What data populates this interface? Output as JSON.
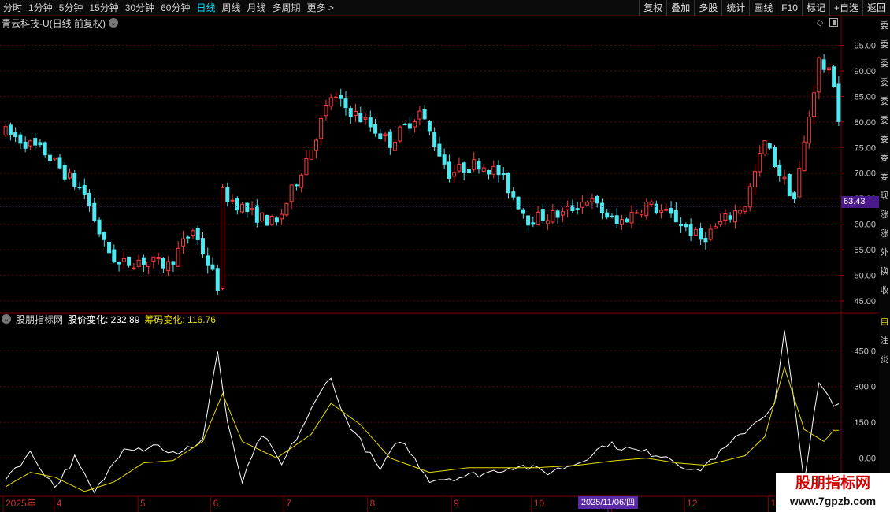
{
  "timeframes": [
    {
      "label": "分时",
      "active": false
    },
    {
      "label": "1分钟",
      "active": false
    },
    {
      "label": "5分钟",
      "active": false
    },
    {
      "label": "15分钟",
      "active": false
    },
    {
      "label": "30分钟",
      "active": false
    },
    {
      "label": "60分钟",
      "active": false
    },
    {
      "label": "日线",
      "active": true
    },
    {
      "label": "周线",
      "active": false
    },
    {
      "label": "月线",
      "active": false
    },
    {
      "label": "多周期",
      "active": false
    },
    {
      "label": "更多 >",
      "active": false
    }
  ],
  "toolbar_right": [
    "复权",
    "叠加",
    "多股",
    "统计",
    "画线",
    "F10",
    "标记",
    "+自选",
    "返回"
  ],
  "main_header": "青云科技-U(日线 前复权)",
  "indicator": {
    "name": "股朋指标网",
    "line1_label": "股价变化: 232.89",
    "line2_label": "筹码变化: 116.76"
  },
  "price_axis": [
    "95.00",
    "90.00",
    "85.00",
    "80.00",
    "75.00",
    "70.00",
    "65.00",
    "60.00",
    "55.00",
    "50.00",
    "45.00"
  ],
  "indicator_axis": [
    "450.0",
    "300.0",
    "150.0",
    "0.00"
  ],
  "current_price": "63.43",
  "months": [
    "2025年",
    "4",
    "5",
    "6",
    "7",
    "8",
    "9",
    "10",
    "11",
    "12",
    "1"
  ],
  "crosshair_date": "2025/11/06/四",
  "right_strip_top": [
    "委",
    "委",
    "委",
    "委",
    "委",
    "委",
    "委",
    "委",
    "委",
    "现",
    "涨",
    "涨",
    "外",
    "换",
    "收"
  ],
  "right_strip_bottom": [
    "自",
    "注",
    "炎"
  ],
  "watermark": {
    "title": "股朋指标网",
    "url": "www.7gpzb.com"
  },
  "colors": {
    "up": "#ff3b3b",
    "down": "#4ee8f0",
    "line1": "#ffffff",
    "line2": "#e6dc00",
    "grid": "#5a0a0a"
  },
  "chart_data": [
    {
      "type": "candlestick",
      "title": "青云科技-U(日线 前复权)",
      "ylim": [
        43,
        98
      ],
      "x_ticks": [
        "2025年",
        "4",
        "5",
        "6",
        "7",
        "8",
        "9",
        "10",
        "11",
        "12",
        "1"
      ],
      "close_path": [
        [
          0,
          78
        ],
        [
          8,
          74
        ],
        [
          16,
          66
        ],
        [
          20,
          56
        ],
        [
          23,
          52
        ],
        [
          27,
          53
        ],
        [
          33,
          52
        ],
        [
          38,
          59
        ],
        [
          43,
          48
        ],
        [
          44,
          66
        ],
        [
          50,
          62
        ],
        [
          55,
          60
        ],
        [
          62,
          75
        ],
        [
          66,
          85
        ],
        [
          73,
          80
        ],
        [
          78,
          76
        ],
        [
          84,
          82
        ],
        [
          90,
          70
        ],
        [
          96,
          72
        ],
        [
          100,
          70
        ],
        [
          106,
          61
        ],
        [
          113,
          62
        ],
        [
          118,
          65
        ],
        [
          124,
          60
        ],
        [
          130,
          64
        ],
        [
          136,
          61
        ],
        [
          141,
          57
        ],
        [
          150,
          64
        ],
        [
          154,
          76
        ],
        [
          157,
          70
        ],
        [
          160,
          65
        ],
        [
          165,
          92
        ],
        [
          168,
          88
        ],
        [
          170,
          73
        ]
      ],
      "current_price": 63.43
    },
    {
      "type": "line",
      "title": "股朋指标网",
      "ylim": [
        -160,
        560
      ],
      "series": [
        {
          "name": "股价变化",
          "current": 232.89,
          "points": [
            [
              0,
              -80
            ],
            [
              5,
              20
            ],
            [
              10,
              -120
            ],
            [
              14,
              0
            ],
            [
              18,
              -150
            ],
            [
              24,
              50
            ],
            [
              28,
              40
            ],
            [
              30,
              60
            ],
            [
              35,
              10
            ],
            [
              40,
              80
            ],
            [
              43,
              450
            ],
            [
              45,
              140
            ],
            [
              48,
              -100
            ],
            [
              52,
              100
            ],
            [
              56,
              -30
            ],
            [
              62,
              200
            ],
            [
              66,
              350
            ],
            [
              68,
              200
            ],
            [
              72,
              70
            ],
            [
              76,
              -50
            ],
            [
              80,
              80
            ],
            [
              86,
              -90
            ],
            [
              92,
              -80
            ],
            [
              98,
              -60
            ],
            [
              104,
              -30
            ],
            [
              110,
              -60
            ],
            [
              116,
              -20
            ],
            [
              122,
              60
            ],
            [
              128,
              30
            ],
            [
              134,
              10
            ],
            [
              140,
              -60
            ],
            [
              146,
              40
            ],
            [
              152,
              150
            ],
            [
              156,
              220
            ],
            [
              158,
              530
            ],
            [
              162,
              -90
            ],
            [
              165,
              310
            ],
            [
              168,
              220
            ]
          ]
        },
        {
          "name": "筹码变化",
          "current": 116.76,
          "points": [
            [
              0,
              -120
            ],
            [
              5,
              -60
            ],
            [
              10,
              -80
            ],
            [
              16,
              -140
            ],
            [
              22,
              -100
            ],
            [
              28,
              -20
            ],
            [
              34,
              -10
            ],
            [
              40,
              70
            ],
            [
              44,
              270
            ],
            [
              48,
              70
            ],
            [
              55,
              0
            ],
            [
              62,
              100
            ],
            [
              66,
              230
            ],
            [
              72,
              140
            ],
            [
              78,
              0
            ],
            [
              86,
              -60
            ],
            [
              94,
              -40
            ],
            [
              100,
              -40
            ],
            [
              108,
              -40
            ],
            [
              116,
              -30
            ],
            [
              124,
              -10
            ],
            [
              130,
              0
            ],
            [
              136,
              -20
            ],
            [
              142,
              -30
            ],
            [
              150,
              10
            ],
            [
              154,
              90
            ],
            [
              158,
              380
            ],
            [
              162,
              120
            ],
            [
              166,
              70
            ],
            [
              168,
              116.76
            ]
          ]
        }
      ]
    }
  ]
}
